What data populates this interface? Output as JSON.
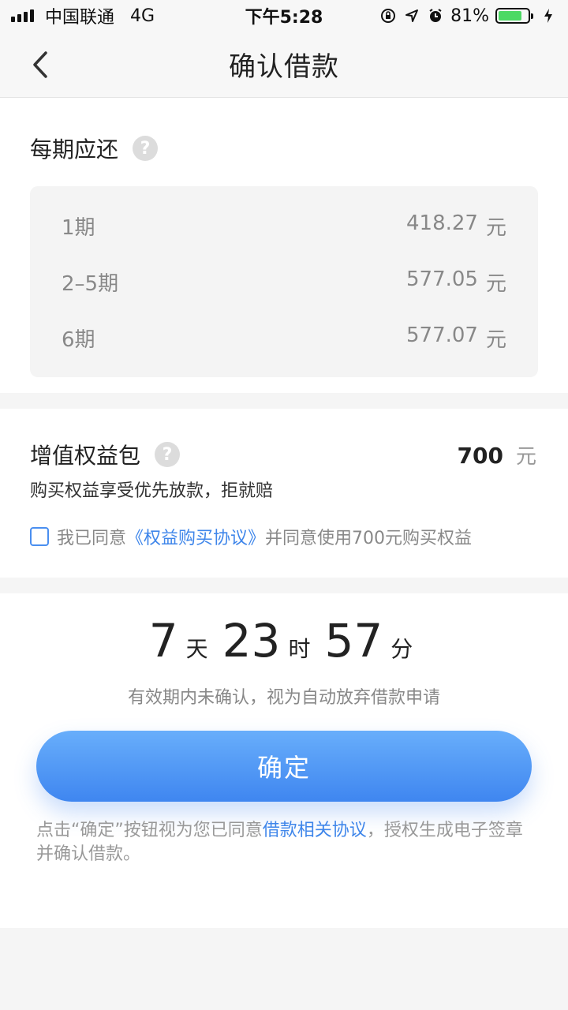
{
  "status_bar": {
    "carrier": "中国联通",
    "network": "4G",
    "time": "下午5:28",
    "battery_percent": "81%",
    "battery_level": 0.81,
    "icons": [
      "rotation-lock-icon",
      "location-icon",
      "alarm-icon",
      "charging-icon"
    ]
  },
  "nav": {
    "title": "确认借款",
    "back_icon": "chevron-left-icon"
  },
  "repayment": {
    "title": "每期应还",
    "help_icon": "?",
    "rows": [
      {
        "period": "1期",
        "amount": "418.27",
        "unit": "元"
      },
      {
        "period": "2–5期",
        "amount": "577.05",
        "unit": "元"
      },
      {
        "period": "6期",
        "amount": "577.07",
        "unit": "元"
      }
    ]
  },
  "benefit": {
    "title": "增值权益包",
    "help_icon": "?",
    "price": "700",
    "unit": "元",
    "description": "购买权益享受优先放款，拒就赔",
    "agree_prefix": "我已同意",
    "agree_link": "《权益购买协议》",
    "agree_suffix": "并同意使用700元购买权益",
    "checked": false
  },
  "countdown": {
    "days": "7",
    "days_unit": "天",
    "hours": "23",
    "hours_unit": "时",
    "minutes": "57",
    "minutes_unit": "分",
    "note": "有效期内未确认，视为自动放弃借款申请"
  },
  "confirm": {
    "button_label": "确定",
    "legal_prefix": "点击“确定”按钮视为您已同意",
    "legal_link": "借款相关协议",
    "legal_suffix": "，授权生成电子签章并确认借款。"
  },
  "colors": {
    "accent": "#3f86ea",
    "button_top": "#68aefb",
    "button_bottom": "#3f86f0",
    "battery": "#4cd964"
  }
}
